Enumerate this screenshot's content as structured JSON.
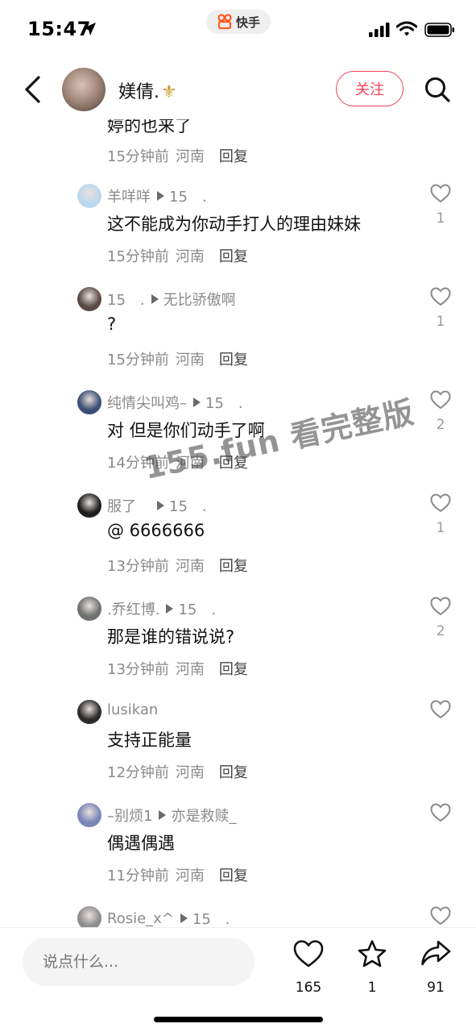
{
  "status_bar": {
    "time": "15:47",
    "app_name": "快手"
  },
  "header": {
    "username": "媄倩.",
    "name_emoji": "⚜",
    "follow_label": "关注"
  },
  "partial_comment": {
    "text": "婷的也来了",
    "time": "15分钟前",
    "location": "河南",
    "reply_label": "回复"
  },
  "comments": [
    {
      "user": "羊咩咩",
      "arrow": true,
      "reply_to": "15　.",
      "text": "这不能成为你动手打人的理由妹妹",
      "time": "15分钟前",
      "location": "河南",
      "reply_label": "回复",
      "likes": "1",
      "avatar_color": "#bcd8f0"
    },
    {
      "user": "15　.",
      "arrow": true,
      "reply_to": "无比骄傲啊",
      "text": "?",
      "time": "15分钟前",
      "location": "河南",
      "reply_label": "回复",
      "likes": "1",
      "avatar_color": "#5a4a44"
    },
    {
      "user": "纯情尖叫鸡–",
      "arrow": true,
      "reply_to": "15　.",
      "text": "对 但是你们动手了啊",
      "time": "14分钟前",
      "location": "河南",
      "reply_label": "回复",
      "likes": "2",
      "avatar_color": "#3c4e74"
    },
    {
      "user": "服了　",
      "arrow": true,
      "reply_to": "15　.",
      "text": "@ 6666666",
      "time": "13分钟前",
      "location": "河南",
      "reply_label": "回复",
      "likes": "1",
      "avatar_color": "#1e1e1e"
    },
    {
      "user": ".乔红博.",
      "arrow": true,
      "reply_to": "15　.",
      "text": "那是谁的错说说?",
      "time": "13分钟前",
      "location": "河南",
      "reply_label": "回复",
      "likes": "2",
      "avatar_color": "#6e7170"
    },
    {
      "user": "lusikan",
      "arrow": false,
      "reply_to": "",
      "text": "支持正能量",
      "time": "12分钟前",
      "location": "河南",
      "reply_label": "回复",
      "likes": "",
      "avatar_color": "#2b2b2b"
    },
    {
      "user": "–别烦1",
      "arrow": true,
      "reply_to": "亦是救赎_",
      "text": "偶遇偶遇",
      "time": "11分钟前",
      "location": "河南",
      "reply_label": "回复",
      "likes": "",
      "avatar_color": "#7a86b8"
    },
    {
      "user": "Rosie_x^",
      "arrow": true,
      "reply_to": "15　.",
      "text": "",
      "time": "",
      "location": "",
      "reply_label": "",
      "likes": "",
      "avatar_color": "#8c8c8c"
    }
  ],
  "watermark": "155.fun 看完整版",
  "bottom_bar": {
    "input_placeholder": "说点什么...",
    "like_count": "165",
    "star_count": "1",
    "share_count": "91"
  },
  "colors": {
    "accent": "#f0435b",
    "meta_gray": "#8a8a8a"
  }
}
